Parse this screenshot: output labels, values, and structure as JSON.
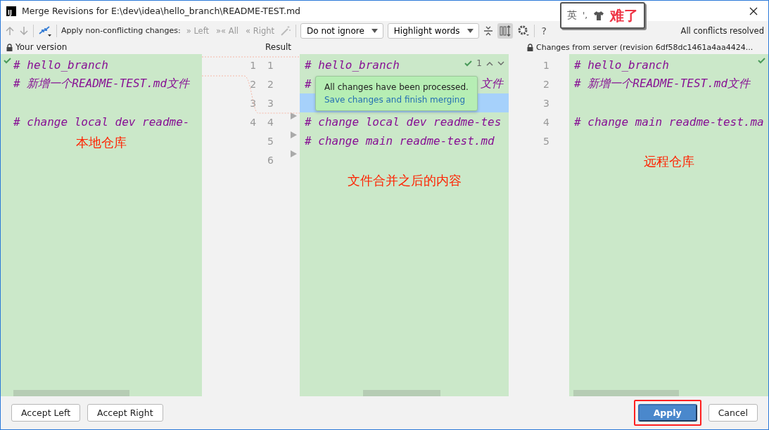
{
  "window": {
    "app_icon": "IJ",
    "title": "Merge Revisions for E:\\dev\\idea\\hello_branch\\README-TEST.md"
  },
  "toolbar": {
    "apply_label": "Apply non-conflicting changes:",
    "apply_buttons": [
      {
        "glyph": "»",
        "label": "Left",
        "disabled": true
      },
      {
        "glyph": "»«",
        "label": "All",
        "disabled": true
      },
      {
        "glyph": "«",
        "label": "Right",
        "disabled": true
      }
    ],
    "dropdowns": [
      {
        "value": "Do not ignore"
      },
      {
        "value": "Highlight words"
      }
    ],
    "sync_scroll": {
      "on": true
    },
    "help": "?",
    "status": "All conflicts resolved"
  },
  "ime_overlay": {
    "mode": "英",
    "punct": "',",
    "sticker": "难了"
  },
  "headers": [
    {
      "label": "Your version",
      "locked": true
    },
    {
      "label": "Result",
      "locked": false
    },
    {
      "label": "Changes from server (revision 6df58dc1461a4aa4424...",
      "locked": true
    }
  ],
  "left": {
    "annotation": "本地仓库",
    "lines": [
      {
        "number": "1",
        "text": "# hello_branch"
      },
      {
        "number": "2",
        "text": "# 新增一个README-TEST.md文件"
      },
      {
        "number": "3"
      },
      {
        "number": "4",
        "text": "# change local dev readme-"
      }
    ]
  },
  "result": {
    "resolved_count": "1",
    "annotation": "文件合并之后的内容",
    "lines": [
      {
        "number": "1",
        "text": "# hello_branch",
        "current": false,
        "apply_arrow": false
      },
      {
        "number": "2",
        "text": "#",
        "text_after": "文件",
        "current": false,
        "apply_arrow": false
      },
      {
        "number": "3",
        "current": true,
        "apply_arrow": false
      },
      {
        "number": "4",
        "text": "# change local dev readme-tes",
        "current": false,
        "apply_arrow": true
      },
      {
        "number": "5",
        "text": "# change main readme-test.md",
        "current": false,
        "apply_arrow": true
      },
      {
        "number": "6",
        "current": false,
        "apply_arrow": true
      }
    ]
  },
  "right": {
    "annotation": "远程仓库",
    "lines": [
      {
        "number": "1",
        "text": "# hello_branch"
      },
      {
        "number": "2",
        "text": "# 新增一个README-TEST.md文件"
      },
      {
        "number": "3"
      },
      {
        "number": "4",
        "text": "# change main readme-test.ma"
      },
      {
        "number": "5"
      }
    ]
  },
  "tooltip": {
    "message": "All changes have been processed.",
    "link": "Save changes and finish merging"
  },
  "footer": {
    "left_buttons": [
      {
        "label": "Accept Left",
        "kind": "plain",
        "highlighted": false
      },
      {
        "label": "Accept Right",
        "kind": "plain",
        "highlighted": false
      }
    ],
    "right_buttons": [
      {
        "label": "Apply",
        "kind": "primary",
        "highlighted": true
      },
      {
        "label": "Cancel",
        "kind": "plain",
        "highlighted": false
      }
    ]
  }
}
